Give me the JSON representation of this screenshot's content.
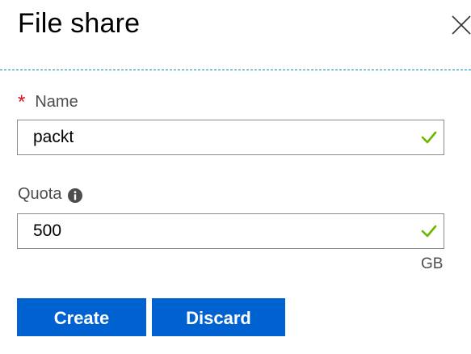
{
  "header": {
    "title": "File share",
    "close_icon": "close-icon"
  },
  "form": {
    "name": {
      "required_marker": "*",
      "label": "Name",
      "value": "packt",
      "status_icon": "checkmark-icon"
    },
    "quota": {
      "label": "Quota",
      "info_icon": "info-icon",
      "value": "500",
      "unit": "GB",
      "status_icon": "checkmark-icon"
    }
  },
  "actions": {
    "create_label": "Create",
    "discard_label": "Discard"
  },
  "colors": {
    "primary_button": "#0062d1",
    "required_star": "#d9111f",
    "valid_check": "#6bb700",
    "divider": "#1c8bc7",
    "field_border": "#8a8a8a",
    "label_text": "#4d4d4d"
  }
}
